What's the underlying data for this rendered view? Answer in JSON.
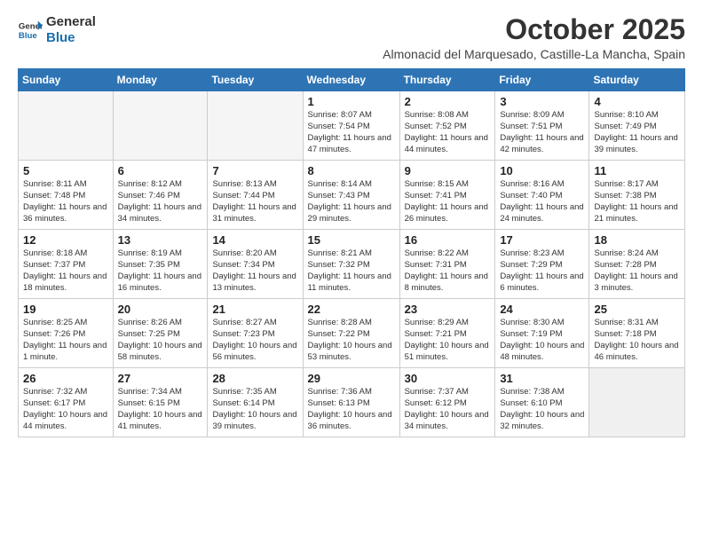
{
  "logo": {
    "line1": "General",
    "line2": "Blue"
  },
  "title": "October 2025",
  "location": "Almonacid del Marquesado, Castille-La Mancha, Spain",
  "headers": [
    "Sunday",
    "Monday",
    "Tuesday",
    "Wednesday",
    "Thursday",
    "Friday",
    "Saturday"
  ],
  "weeks": [
    [
      {
        "day": "",
        "info": ""
      },
      {
        "day": "",
        "info": ""
      },
      {
        "day": "",
        "info": ""
      },
      {
        "day": "1",
        "info": "Sunrise: 8:07 AM\nSunset: 7:54 PM\nDaylight: 11 hours and 47 minutes."
      },
      {
        "day": "2",
        "info": "Sunrise: 8:08 AM\nSunset: 7:52 PM\nDaylight: 11 hours and 44 minutes."
      },
      {
        "day": "3",
        "info": "Sunrise: 8:09 AM\nSunset: 7:51 PM\nDaylight: 11 hours and 42 minutes."
      },
      {
        "day": "4",
        "info": "Sunrise: 8:10 AM\nSunset: 7:49 PM\nDaylight: 11 hours and 39 minutes."
      }
    ],
    [
      {
        "day": "5",
        "info": "Sunrise: 8:11 AM\nSunset: 7:48 PM\nDaylight: 11 hours and 36 minutes."
      },
      {
        "day": "6",
        "info": "Sunrise: 8:12 AM\nSunset: 7:46 PM\nDaylight: 11 hours and 34 minutes."
      },
      {
        "day": "7",
        "info": "Sunrise: 8:13 AM\nSunset: 7:44 PM\nDaylight: 11 hours and 31 minutes."
      },
      {
        "day": "8",
        "info": "Sunrise: 8:14 AM\nSunset: 7:43 PM\nDaylight: 11 hours and 29 minutes."
      },
      {
        "day": "9",
        "info": "Sunrise: 8:15 AM\nSunset: 7:41 PM\nDaylight: 11 hours and 26 minutes."
      },
      {
        "day": "10",
        "info": "Sunrise: 8:16 AM\nSunset: 7:40 PM\nDaylight: 11 hours and 24 minutes."
      },
      {
        "day": "11",
        "info": "Sunrise: 8:17 AM\nSunset: 7:38 PM\nDaylight: 11 hours and 21 minutes."
      }
    ],
    [
      {
        "day": "12",
        "info": "Sunrise: 8:18 AM\nSunset: 7:37 PM\nDaylight: 11 hours and 18 minutes."
      },
      {
        "day": "13",
        "info": "Sunrise: 8:19 AM\nSunset: 7:35 PM\nDaylight: 11 hours and 16 minutes."
      },
      {
        "day": "14",
        "info": "Sunrise: 8:20 AM\nSunset: 7:34 PM\nDaylight: 11 hours and 13 minutes."
      },
      {
        "day": "15",
        "info": "Sunrise: 8:21 AM\nSunset: 7:32 PM\nDaylight: 11 hours and 11 minutes."
      },
      {
        "day": "16",
        "info": "Sunrise: 8:22 AM\nSunset: 7:31 PM\nDaylight: 11 hours and 8 minutes."
      },
      {
        "day": "17",
        "info": "Sunrise: 8:23 AM\nSunset: 7:29 PM\nDaylight: 11 hours and 6 minutes."
      },
      {
        "day": "18",
        "info": "Sunrise: 8:24 AM\nSunset: 7:28 PM\nDaylight: 11 hours and 3 minutes."
      }
    ],
    [
      {
        "day": "19",
        "info": "Sunrise: 8:25 AM\nSunset: 7:26 PM\nDaylight: 11 hours and 1 minute."
      },
      {
        "day": "20",
        "info": "Sunrise: 8:26 AM\nSunset: 7:25 PM\nDaylight: 10 hours and 58 minutes."
      },
      {
        "day": "21",
        "info": "Sunrise: 8:27 AM\nSunset: 7:23 PM\nDaylight: 10 hours and 56 minutes."
      },
      {
        "day": "22",
        "info": "Sunrise: 8:28 AM\nSunset: 7:22 PM\nDaylight: 10 hours and 53 minutes."
      },
      {
        "day": "23",
        "info": "Sunrise: 8:29 AM\nSunset: 7:21 PM\nDaylight: 10 hours and 51 minutes."
      },
      {
        "day": "24",
        "info": "Sunrise: 8:30 AM\nSunset: 7:19 PM\nDaylight: 10 hours and 48 minutes."
      },
      {
        "day": "25",
        "info": "Sunrise: 8:31 AM\nSunset: 7:18 PM\nDaylight: 10 hours and 46 minutes."
      }
    ],
    [
      {
        "day": "26",
        "info": "Sunrise: 7:32 AM\nSunset: 6:17 PM\nDaylight: 10 hours and 44 minutes."
      },
      {
        "day": "27",
        "info": "Sunrise: 7:34 AM\nSunset: 6:15 PM\nDaylight: 10 hours and 41 minutes."
      },
      {
        "day": "28",
        "info": "Sunrise: 7:35 AM\nSunset: 6:14 PM\nDaylight: 10 hours and 39 minutes."
      },
      {
        "day": "29",
        "info": "Sunrise: 7:36 AM\nSunset: 6:13 PM\nDaylight: 10 hours and 36 minutes."
      },
      {
        "day": "30",
        "info": "Sunrise: 7:37 AM\nSunset: 6:12 PM\nDaylight: 10 hours and 34 minutes."
      },
      {
        "day": "31",
        "info": "Sunrise: 7:38 AM\nSunset: 6:10 PM\nDaylight: 10 hours and 32 minutes."
      },
      {
        "day": "",
        "info": ""
      }
    ]
  ]
}
